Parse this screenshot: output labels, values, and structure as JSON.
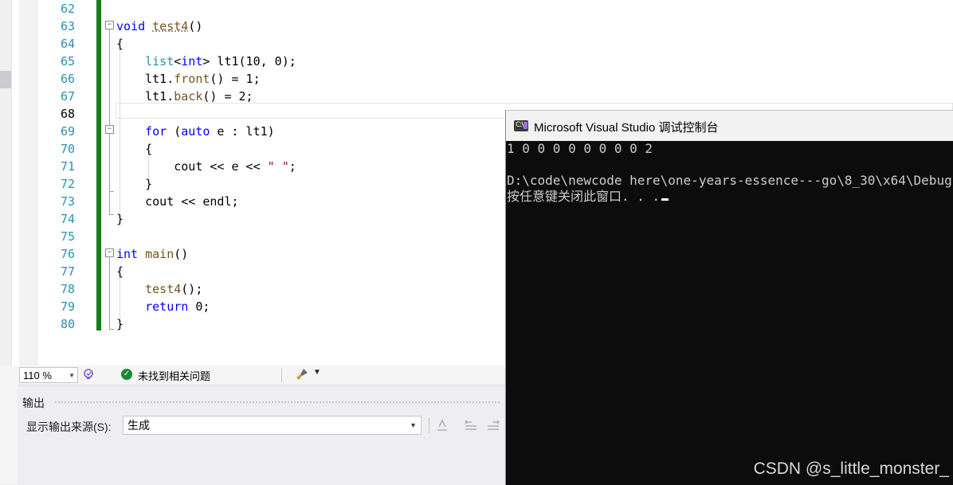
{
  "editor": {
    "lines": [
      {
        "num": "62",
        "tokens": []
      },
      {
        "num": "63",
        "tokens": [
          {
            "t": "void",
            "c": "kw"
          },
          {
            "t": " "
          },
          {
            "t": "test4",
            "c": "fn squig"
          },
          {
            "t": "()"
          }
        ]
      },
      {
        "num": "64",
        "tokens": [
          {
            "t": "{"
          }
        ]
      },
      {
        "num": "65",
        "tokens": [
          {
            "t": "    "
          },
          {
            "t": "list",
            "c": "ty"
          },
          {
            "t": "<"
          },
          {
            "t": "int",
            "c": "kw"
          },
          {
            "t": "> lt1(10, 0);"
          }
        ]
      },
      {
        "num": "66",
        "tokens": [
          {
            "t": "    lt1."
          },
          {
            "t": "front",
            "c": "fn"
          },
          {
            "t": "() = 1;"
          }
        ]
      },
      {
        "num": "67",
        "tokens": [
          {
            "t": "    lt1."
          },
          {
            "t": "back",
            "c": "fn"
          },
          {
            "t": "() = 2;"
          }
        ]
      },
      {
        "num": "68",
        "tokens": []
      },
      {
        "num": "69",
        "tokens": [
          {
            "t": "    "
          },
          {
            "t": "for",
            "c": "kw"
          },
          {
            "t": " ("
          },
          {
            "t": "auto",
            "c": "kw"
          },
          {
            "t": " e : lt1)"
          }
        ]
      },
      {
        "num": "70",
        "tokens": [
          {
            "t": "    {"
          }
        ]
      },
      {
        "num": "71",
        "tokens": [
          {
            "t": "        cout << e << "
          },
          {
            "t": "\" \"",
            "c": "str"
          },
          {
            "t": ";"
          }
        ]
      },
      {
        "num": "72",
        "tokens": [
          {
            "t": "    }"
          }
        ]
      },
      {
        "num": "73",
        "tokens": [
          {
            "t": "    cout << endl;"
          }
        ]
      },
      {
        "num": "74",
        "tokens": [
          {
            "t": "}"
          }
        ]
      },
      {
        "num": "75",
        "tokens": []
      },
      {
        "num": "76",
        "tokens": [
          {
            "t": "int",
            "c": "kw"
          },
          {
            "t": " "
          },
          {
            "t": "main",
            "c": "fn"
          },
          {
            "t": "()"
          }
        ]
      },
      {
        "num": "77",
        "tokens": [
          {
            "t": "{"
          }
        ]
      },
      {
        "num": "78",
        "tokens": [
          {
            "t": "    "
          },
          {
            "t": "test4",
            "c": "fn"
          },
          {
            "t": "();"
          }
        ]
      },
      {
        "num": "79",
        "tokens": [
          {
            "t": "    "
          },
          {
            "t": "return",
            "c": "kw"
          },
          {
            "t": " 0;"
          }
        ]
      },
      {
        "num": "80",
        "tokens": [
          {
            "t": "}"
          }
        ]
      }
    ],
    "current_line": "68"
  },
  "status": {
    "zoom": "110 %",
    "issues": "未找到相关问题"
  },
  "output": {
    "title": "输出",
    "source_label": "显示输出来源(S):",
    "source_value": "生成"
  },
  "console": {
    "title": "Microsoft Visual Studio 调试控制台",
    "icon_text": "C:\\",
    "lines": [
      "1 0 0 0 0 0 0 0 0 2",
      "",
      "D:\\code\\newcode here\\one-years-essence---go\\8_30\\x64\\Debug",
      "按任意键关闭此窗口. . ."
    ]
  },
  "watermark": "CSDN @s_little_monster_",
  "colors": {
    "change_bar": "#108010",
    "keyword": "#0000ff",
    "type": "#2b91af",
    "function": "#74531f",
    "string": "#a31515",
    "console_bg": "#0c0c0c"
  }
}
